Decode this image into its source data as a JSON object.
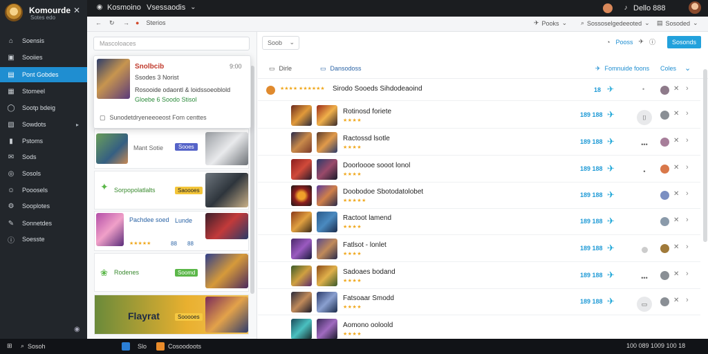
{
  "topbar": {
    "tab1": "Kosmoino",
    "tab2": "Vsessaodis",
    "user": "Dello 888"
  },
  "brand": {
    "name": "Komourde",
    "sub": "Sotes edo"
  },
  "sidebar": {
    "items": [
      {
        "label": "Soensis"
      },
      {
        "label": "Sooiies"
      },
      {
        "label": "Pont Gobdes"
      },
      {
        "label": "Stomeel"
      },
      {
        "label": "Sootp bdeig"
      },
      {
        "label": "Sowdots"
      },
      {
        "label": "Pstoms"
      },
      {
        "label": "Sods"
      },
      {
        "label": "Sosols"
      },
      {
        "label": "Pooosels"
      },
      {
        "label": "Sooplotes"
      },
      {
        "label": "Sonnetdes"
      },
      {
        "label": "Soesste"
      }
    ]
  },
  "toolbar": {
    "path": "Sterios",
    "btn1": "Pooks",
    "btn2": "Sossoselgedeeoted",
    "btn3": "Sosoded"
  },
  "mid": {
    "search_placeholder": "Mascoloaces",
    "cards": [
      {
        "title": "Mant Sotie",
        "badge": "Sooes"
      },
      {
        "title": "Sorpopolatlalts",
        "badge": "Saoooes"
      },
      {
        "title": "Pachdee soed",
        "badge": "Lunde",
        "meta1": "88",
        "meta2": "88"
      },
      {
        "title": "Rodenes",
        "badge": "Soomd"
      },
      {
        "title": "Flayrat",
        "badge": "Sooooes"
      }
    ]
  },
  "popup": {
    "title": "Snolbcib",
    "time": "9:00",
    "line1": "Ssodes 3 Norist",
    "line2": "Rosooide odaontl & loidssoeoblold",
    "line3": "Gloebe 6 Soodo Stisol",
    "footer": "Sunodetdryeneeoeost Fom centtes"
  },
  "right": {
    "filter": "Soob",
    "header": {
      "col1": "Dirle",
      "col2": "Dansodoss",
      "action": "Fomnuide foons",
      "action2": "Coles"
    },
    "toolbar": {
      "b1": "Pooss",
      "b2": "Sosonds"
    },
    "pinned": {
      "title": "Sirodo Sooeds Sihdodeaoind",
      "price": "18"
    },
    "rows": [
      {
        "title": "Rotinosd foriete",
        "stars": "★★★★",
        "price": "189 188"
      },
      {
        "title": "Ractossd lsotle",
        "stars": "★★★★",
        "price": "189 188"
      },
      {
        "title": "Doorloooe sooot lonol",
        "stars": "★★★★",
        "price": "189 188"
      },
      {
        "title": "Doobodoe Sbotodatolobet",
        "stars": "★★★★★",
        "price": "189 188"
      },
      {
        "title": "Ractoot lamend",
        "stars": "★★★★",
        "price": "189 188"
      },
      {
        "title": "Fatlsot - lonlet",
        "stars": "★★★★",
        "price": "189 188"
      },
      {
        "title": "Sadoaes bodand",
        "stars": "★★★★",
        "price": "189 188"
      },
      {
        "title": "Fatsoaar Smodd",
        "stars": "★★★★",
        "price": "189 188"
      },
      {
        "title": "Aomono ooloold",
        "stars": "★★★★",
        "price": "189 188"
      }
    ]
  },
  "taskbar": {
    "left": "Sosoh",
    "app1": "Slo",
    "app2": "Cosoodoots",
    "clock": "100 089 1009 100 18"
  }
}
